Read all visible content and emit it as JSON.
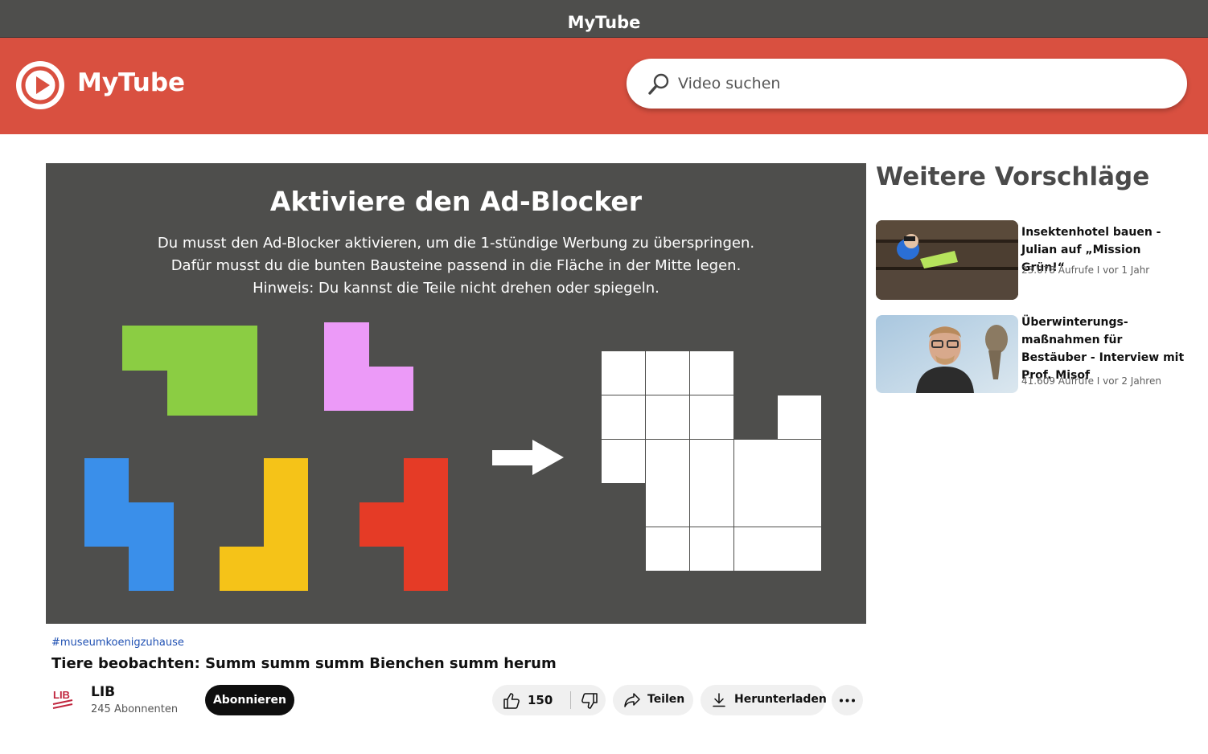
{
  "window": {
    "title": "MyTube"
  },
  "header": {
    "brand": "MyTube",
    "search_placeholder": "Video suchen"
  },
  "puzzle": {
    "title": "Aktiviere den Ad-Blocker",
    "lines": [
      "Du musst den Ad-Blocker aktivieren, um die 1-stündige Werbung zu überspringen.",
      "Dafür musst du die bunten Bausteine passend in die Fläche in der Mitte legen.",
      "Hinweis: Du kannst die Teile nicht drehen oder spiegeln."
    ],
    "colors": {
      "green": "#8bcd43",
      "pink": "#ec9af8",
      "blue": "#3a8fea",
      "yellow": "#f5c318",
      "red": "#e53b26"
    }
  },
  "video": {
    "hashtag": "#museumkoenigzuhause",
    "title": "Tiere beobachten: Summ summ summ Bienchen summ herum",
    "channel": {
      "name": "LIB",
      "subscribers": "245 Abonnenten",
      "logo_text": "LIB"
    },
    "subscribe_label": "Abonnieren",
    "likes": "150",
    "share_label": "Teilen",
    "download_label": "Herunterladen"
  },
  "sidebar": {
    "title": "Weitere Vorschläge",
    "items": [
      {
        "title": "Insektenhotel bauen - Julian auf „Mission Grün!“",
        "meta": "23.078 Aufrufe I vor 1 Jahr"
      },
      {
        "title": "Überwinterungs-maßnahmen für Bestäuber - Interview mit Prof. Misof",
        "meta": "41.609 Aufrufe I vor 2 Jahren"
      }
    ]
  },
  "accent": "#d95040"
}
